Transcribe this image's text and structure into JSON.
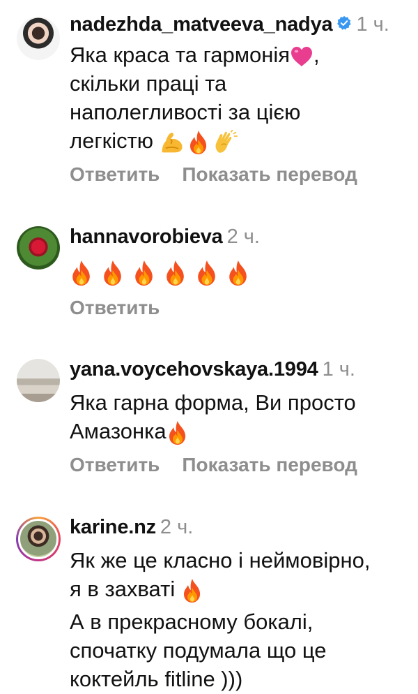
{
  "comments": [
    {
      "username": "nadezhda_matveeva_nadya",
      "verified": true,
      "time": "1 ч.",
      "text_lines": [
        "Яка краса та гармонія",
        ", ",
        "скільки праці та",
        "наполегливості за цією",
        "легкістю "
      ],
      "emoji": [
        "pink-heart-icon",
        "flexed-biceps-icon",
        "fire-icon",
        "clapping-hands-icon"
      ],
      "reply_label": "Ответить",
      "translate_label": "Показать перевод"
    },
    {
      "username": "hannavorobieva",
      "verified": false,
      "time": "2 ч.",
      "emoji": [
        "fire-icon",
        "fire-icon",
        "fire-icon",
        "fire-icon",
        "fire-icon",
        "fire-icon"
      ],
      "reply_label": "Ответить"
    },
    {
      "username": "yana.voycehovskaya.1994",
      "verified": false,
      "time": "1 ч.",
      "text_lines": [
        "Яка гарна форма, Ви просто",
        "Амазонка"
      ],
      "emoji": [
        "fire-icon"
      ],
      "reply_label": "Ответить",
      "translate_label": "Показать перевод"
    },
    {
      "username": "karine.nz",
      "verified": false,
      "time": "2 ч.",
      "text_lines": [
        "Як же це класно і неймовірно,",
        "я в захваті ",
        "А в прекрасному бокалі,",
        "спочатку подумала що це",
        "коктейль fitline )))"
      ],
      "emoji": [
        "fire-icon"
      ]
    }
  ],
  "colors": {
    "text": "#111111",
    "muted": "#8e8e8e",
    "verified_blue": "#3897f0",
    "story_ring": [
      "#f9a23a",
      "#e4405f",
      "#c13584",
      "#833ab4"
    ]
  }
}
